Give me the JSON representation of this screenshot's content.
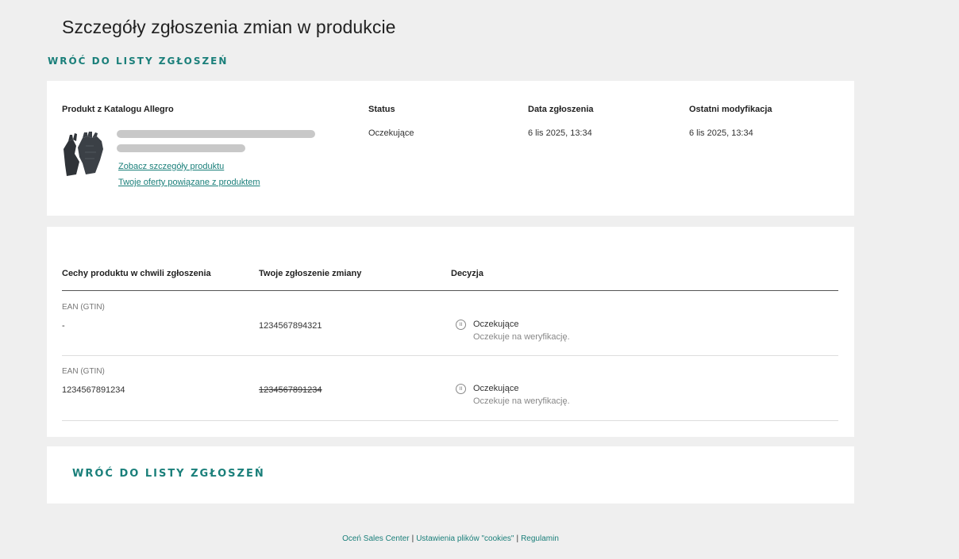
{
  "page": {
    "title": "Szczegóły zgłoszenia zmian w produkcie",
    "back_label": "WRÓĆ DO LISTY ZGŁOSZEŃ"
  },
  "summary": {
    "product_header": "Produkt z Katalogu Allegro",
    "status_header": "Status",
    "status_value": "Oczekujące",
    "date_header": "Data zgłoszenia",
    "date_value": "6 lis 2025, 13:34",
    "modified_header": "Ostatni modyfikacja",
    "modified_value": "6 lis 2025, 13:34",
    "product_links": [
      "Zobacz szczegóły produktu",
      "Twoje oferty powiązane z produktem"
    ]
  },
  "changes": {
    "headers": [
      "Cechy produktu w chwili zgłoszenia",
      "Twoje zgłoszenie zmiany",
      "Decyzja"
    ],
    "rows": [
      {
        "attribute": "EAN (GTIN)",
        "old_value": "-",
        "new_value": "1234567894321",
        "new_struck": false,
        "decision_status": "Oczekujące",
        "decision_note": "Oczekuje na weryfikację."
      },
      {
        "attribute": "EAN (GTIN)",
        "old_value": "1234567891234",
        "new_value": "1234567891234",
        "new_struck": true,
        "decision_status": "Oczekujące",
        "decision_note": "Oczekuje na weryfikację."
      }
    ]
  },
  "footer": {
    "links": [
      "Oceń Sales Center",
      "Ustawienia plików \"cookies\"",
      "Regulamin"
    ]
  },
  "icons": {
    "pending": "pause-circle-icon",
    "product": "gloves-product-image"
  },
  "colors": {
    "accent": "#1a7f7a",
    "background": "#efefef"
  }
}
